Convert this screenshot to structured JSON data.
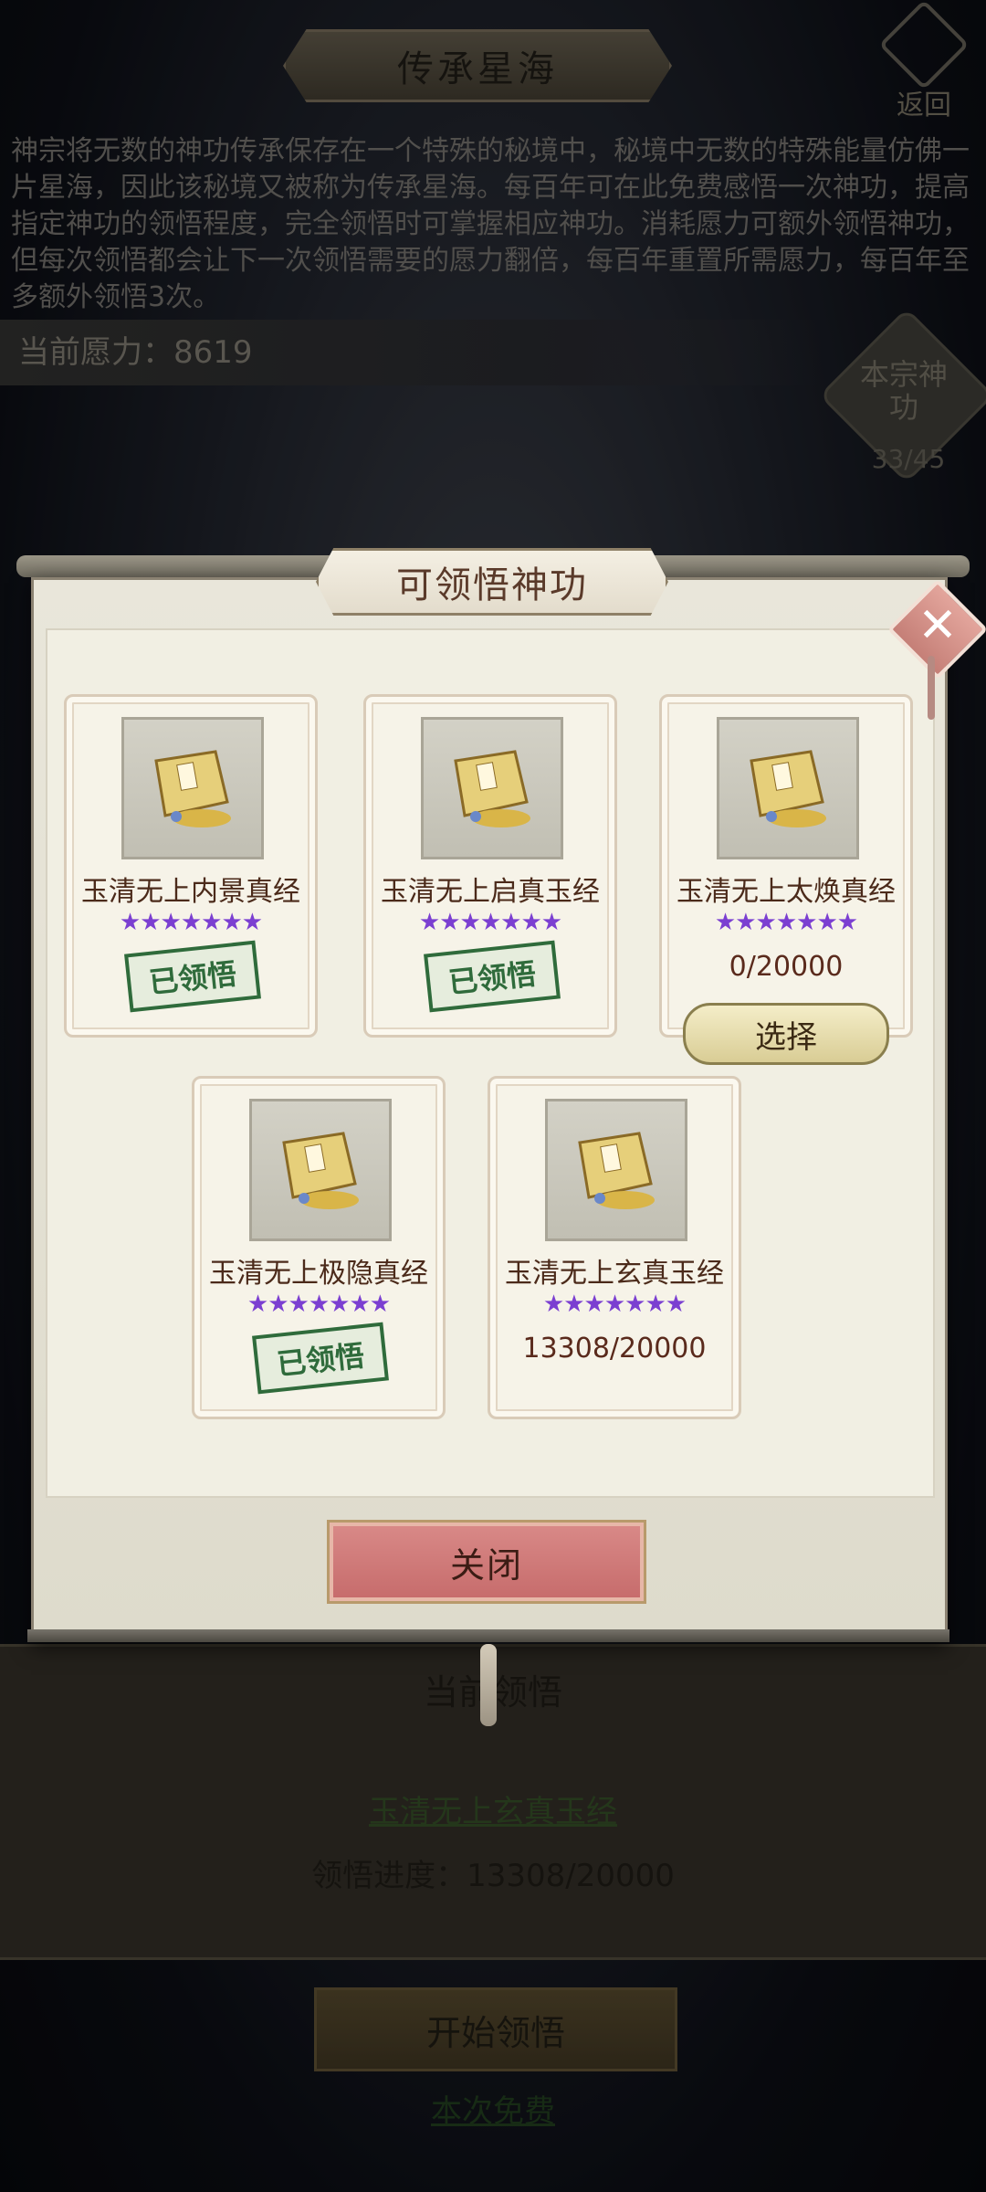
{
  "background": {
    "title": "传承星海",
    "back_label": "返回",
    "intro_text": "神宗将无数的神功传承保存在一个特殊的秘境中，秘境中无数的特殊能量仿佛一片星海，因此该秘境又被称为传承星海。每百年可在此免费感悟一次神功，提高指定神功的领悟程度，完全领悟时可掌握相应神功。消耗愿力可额外领悟神功，但每次领悟都会让下一次领悟需要的愿力翻倍，每百年重置所需愿力，每百年至多额外领悟3次。",
    "wish_power": "当前愿力：8619",
    "sect_label": "本宗神功",
    "sect_count": "33/45",
    "current_title": "当前领悟",
    "current_name": "玉清无上玄真玉经",
    "current_progress": "领悟进度：13308/20000",
    "start_button": "开始领悟",
    "free_text": "本次免费"
  },
  "modal": {
    "title": "可领悟神功",
    "close_button": "关闭",
    "select_button": "选择",
    "cards": [
      {
        "name": "玉清无上内景真经",
        "stars": "★★★★★★★",
        "status": "已领悟"
      },
      {
        "name": "玉清无上启真玉经",
        "stars": "★★★★★★★",
        "status": "已领悟"
      },
      {
        "name": "玉清无上太焕真经",
        "stars": "★★★★★★★",
        "progress": "0/20000"
      },
      {
        "name": "玉清无上极隐真经",
        "stars": "★★★★★★★",
        "status": "已领悟"
      },
      {
        "name": "玉清无上玄真玉经",
        "stars": "★★★★★★★",
        "progress": "13308/20000"
      }
    ]
  },
  "colors": {
    "star": "#7b3fd1",
    "stamp": "#2f6b3b",
    "close_button": "#c66b6b",
    "select_button": "#d9cd95"
  }
}
